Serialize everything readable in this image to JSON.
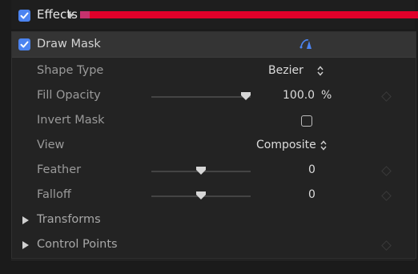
{
  "effects": {
    "label": "Effects",
    "checked": true
  },
  "draw_mask": {
    "label": "Draw Mask",
    "checked": true,
    "icon": "bezier-mask-tool-icon"
  },
  "params": {
    "shape_type": {
      "label": "Shape Type",
      "value": "Bezier"
    },
    "fill_opacity": {
      "label": "Fill Opacity",
      "value": "100.0",
      "unit": "%",
      "slider_fraction": 1.0
    },
    "invert_mask": {
      "label": "Invert Mask",
      "checked": false
    },
    "view": {
      "label": "View",
      "value": "Composite"
    },
    "feather": {
      "label": "Feather",
      "value": "0",
      "slider_fraction": 0.5
    },
    "falloff": {
      "label": "Falloff",
      "value": "0",
      "slider_fraction": 0.5
    }
  },
  "groups": {
    "transforms": {
      "label": "Transforms",
      "expanded": false
    },
    "control_points": {
      "label": "Control Points",
      "expanded": false
    }
  },
  "colors": {
    "accent_checkbox": "#4c84f0",
    "highlight_bar": "#e0002a"
  }
}
